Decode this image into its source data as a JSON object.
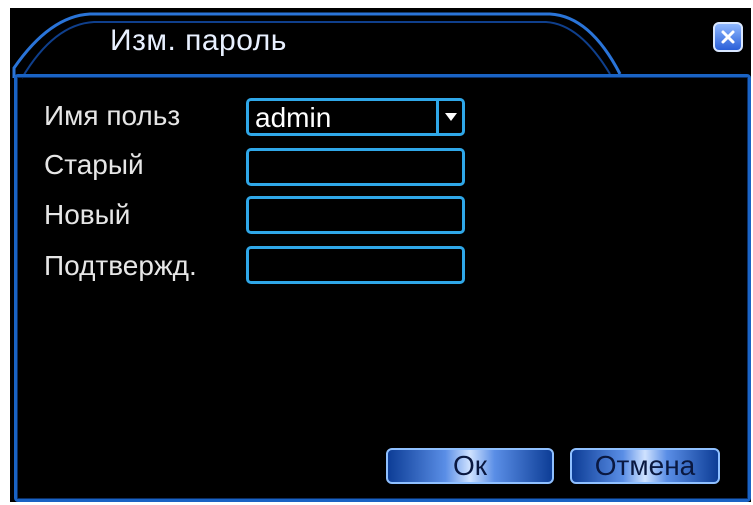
{
  "dialog": {
    "title": "Изм. пароль",
    "close_icon": "close-icon",
    "colors": {
      "background": "#000000",
      "frame": "#1a63c4",
      "field_border": "#2fa7e8",
      "text": "#e6e6e6"
    }
  },
  "form": {
    "user_label": "Имя польз",
    "user_value": "admin",
    "old_label": "Старый",
    "old_value": "",
    "new_label": "Новый",
    "new_value": "",
    "confirm_label": "Подтвержд.",
    "confirm_value": ""
  },
  "buttons": {
    "ok_label": "Ок",
    "cancel_label": "Отмена"
  }
}
